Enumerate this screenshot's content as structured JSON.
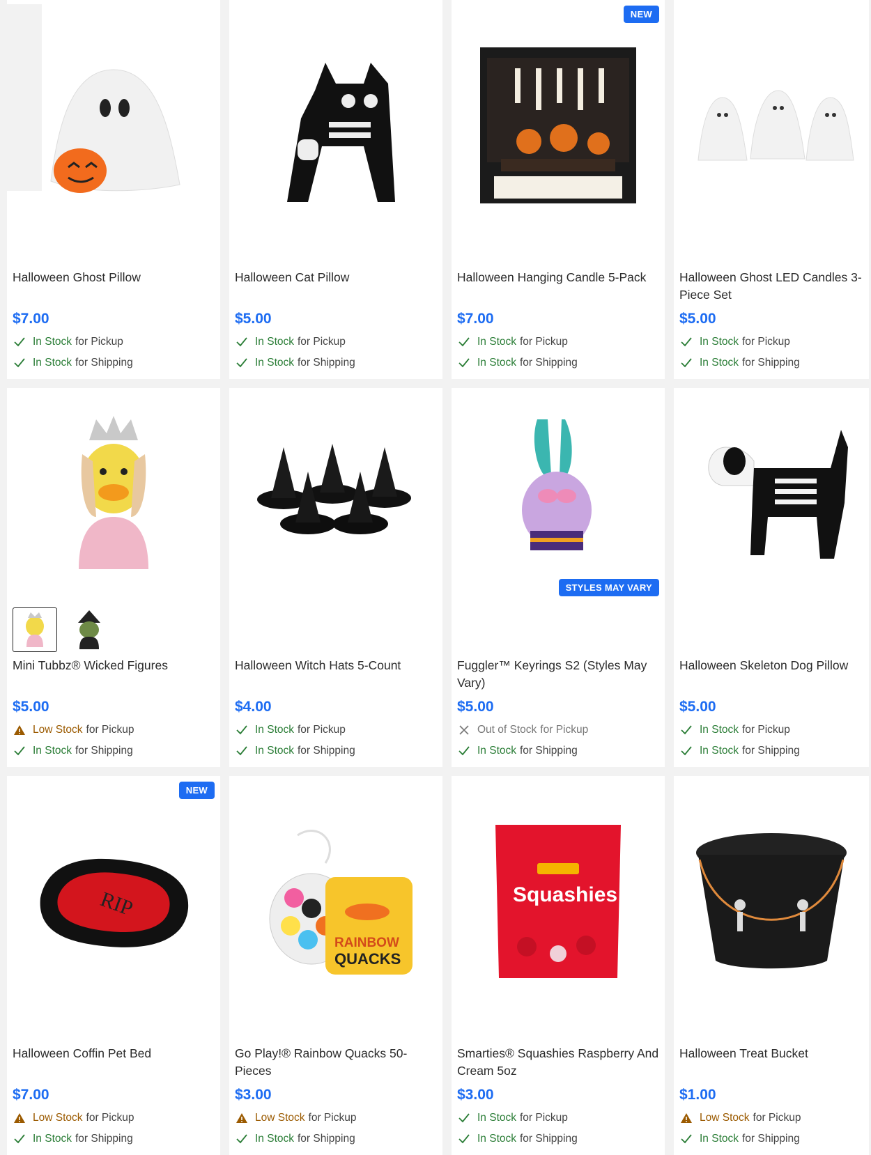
{
  "products": [
    {
      "name": "Halloween Ghost Pillow",
      "price": "$7.00",
      "badge": "",
      "image": "ghost-pillow-image",
      "pickup": {
        "status": "In Stock",
        "type": "in",
        "suffix": "for Pickup"
      },
      "shipping": {
        "status": "In Stock",
        "type": "in",
        "suffix": "for Shipping"
      }
    },
    {
      "name": "Halloween Cat Pillow",
      "price": "$5.00",
      "badge": "",
      "image": "cat-pillow-image",
      "pickup": {
        "status": "In Stock",
        "type": "in",
        "suffix": "for Pickup"
      },
      "shipping": {
        "status": "In Stock",
        "type": "in",
        "suffix": "for Shipping"
      }
    },
    {
      "name": "Halloween Hanging Candle 5-Pack",
      "price": "$7.00",
      "badge": "NEW",
      "image": "hanging-candle-image",
      "pickup": {
        "status": "In Stock",
        "type": "in",
        "suffix": "for Pickup"
      },
      "shipping": {
        "status": "In Stock",
        "type": "in",
        "suffix": "for Shipping"
      }
    },
    {
      "name": "Halloween Ghost LED Candles 3-Piece Set",
      "price": "$5.00",
      "badge": "",
      "image": "ghost-candles-image",
      "pickup": {
        "status": "In Stock",
        "type": "in",
        "suffix": "for Pickup"
      },
      "shipping": {
        "status": "In Stock",
        "type": "in",
        "suffix": "for Shipping"
      }
    },
    {
      "name": "Mini Tubbz® Wicked Figures",
      "price": "$5.00",
      "badge": "",
      "image": "tubbz-duck-image",
      "pickup": {
        "status": "Low Stock",
        "type": "low",
        "suffix": "for Pickup"
      },
      "shipping": {
        "status": "In Stock",
        "type": "in",
        "suffix": "for Shipping"
      }
    },
    {
      "name": "Halloween Witch Hats 5-Count",
      "price": "$4.00",
      "badge": "",
      "image": "witch-hats-image",
      "pickup": {
        "status": "In Stock",
        "type": "in",
        "suffix": "for Pickup"
      },
      "shipping": {
        "status": "In Stock",
        "type": "in",
        "suffix": "for Shipping"
      }
    },
    {
      "name": "Fuggler™ Keyrings S2 (Styles May Vary)",
      "price": "$5.00",
      "badge": "STYLES MAY VARY",
      "image": "fuggler-keyring-image",
      "pickup": {
        "status": "Out of Stock",
        "type": "out",
        "suffix": "for Pickup"
      },
      "shipping": {
        "status": "In Stock",
        "type": "in",
        "suffix": "for Shipping"
      }
    },
    {
      "name": "Halloween Skeleton Dog Pillow",
      "price": "$5.00",
      "badge": "",
      "image": "skeleton-dog-image",
      "pickup": {
        "status": "In Stock",
        "type": "in",
        "suffix": "for Pickup"
      },
      "shipping": {
        "status": "In Stock",
        "type": "in",
        "suffix": "for Shipping"
      }
    },
    {
      "name": "Halloween Coffin Pet Bed",
      "price": "$7.00",
      "badge": "NEW",
      "image": "coffin-bed-image",
      "pickup": {
        "status": "Low Stock",
        "type": "low",
        "suffix": "for Pickup"
      },
      "shipping": {
        "status": "In Stock",
        "type": "in",
        "suffix": "for Shipping"
      }
    },
    {
      "name": "Go Play!® Rainbow Quacks 50-Pieces",
      "price": "$3.00",
      "badge": "",
      "image": "rainbow-quacks-image",
      "pickup": {
        "status": "Low Stock",
        "type": "low",
        "suffix": "for Pickup"
      },
      "shipping": {
        "status": "In Stock",
        "type": "in",
        "suffix": "for Shipping"
      }
    },
    {
      "name": "Smarties® Squashies Raspberry And Cream 5oz",
      "price": "$3.00",
      "badge": "",
      "image": "squashies-image",
      "pickup": {
        "status": "In Stock",
        "type": "in",
        "suffix": "for Pickup"
      },
      "shipping": {
        "status": "In Stock",
        "type": "in",
        "suffix": "for Shipping"
      }
    },
    {
      "name": "Halloween Treat Bucket",
      "price": "$1.00",
      "badge": "",
      "image": "treat-bucket-image",
      "pickup": {
        "status": "Low Stock",
        "type": "low",
        "suffix": "for Pickup"
      },
      "shipping": {
        "status": "In Stock",
        "type": "in",
        "suffix": "for Shipping"
      }
    }
  ],
  "colors": {
    "price": "#1d6cf2",
    "badge": "#1d6cf2",
    "in_stock": "#2a7d36",
    "low_stock": "#9b5a00",
    "out_of_stock": "#777777"
  }
}
